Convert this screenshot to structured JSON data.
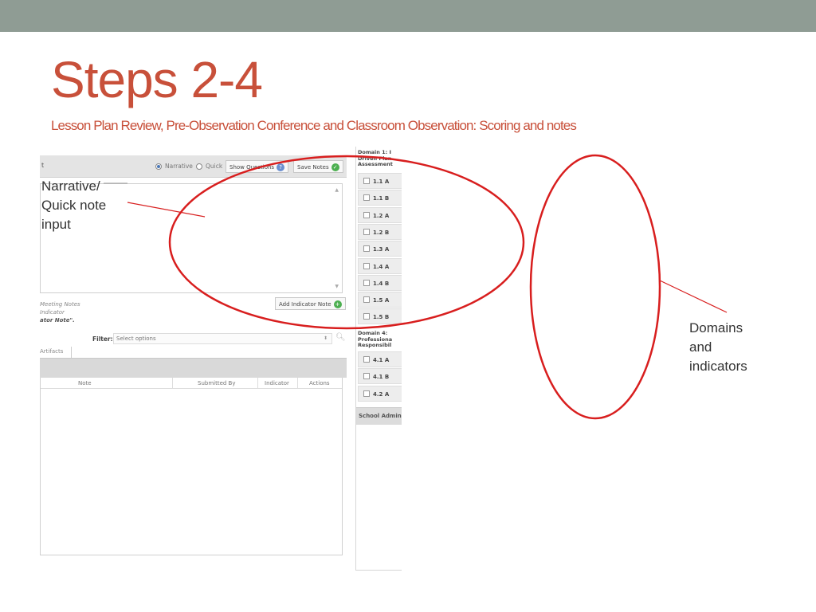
{
  "slide": {
    "title": "Steps 2-4",
    "subtitle": "Lesson Plan Review, Pre-Observation Conference and Classroom Observation: Scoring and notes"
  },
  "note_toolbar": {
    "title_fragment": "t",
    "narrative_label": "Narrative",
    "quick_label": "Quick",
    "selected_mode": "Narrative",
    "show_questions_label": "Show Questions",
    "save_notes_label": "Save Notes"
  },
  "instructions": {
    "line1": "Meeting Notes",
    "line2": "Indicator",
    "line3": "ator Note\"."
  },
  "add_indicator_note_label": "Add Indicator Note",
  "filter": {
    "label": "Filter:",
    "placeholder": "Select options"
  },
  "tabs": {
    "artifacts": "Artifacts"
  },
  "notes_table": {
    "columns": [
      "Note",
      "Submitted By",
      "Indicator",
      "Actions"
    ]
  },
  "domains": {
    "domain1_header": "Domain 1: I\nDriven Plan\nAssessment",
    "domain1_items": [
      "1.1 A",
      "1.1 B",
      "1.2 A",
      "1.2 B",
      "1.3 A",
      "1.4 A",
      "1.4 B",
      "1.5 A",
      "1.5 B"
    ],
    "domain4_header": "Domain 4:\nProfessiona\nResponsibil",
    "domain4_items": [
      "4.1 A",
      "4.1 B",
      "4.2 A"
    ],
    "school_admin_label": "School Admin"
  },
  "callouts": {
    "narrative": [
      "Narrative/",
      "Quick note",
      "input"
    ],
    "domains": [
      "Domains",
      "and",
      "indicators"
    ]
  },
  "colors": {
    "title": "#c8503a",
    "top_bar": "#8f9c94",
    "ellipse": "#d81e1e"
  }
}
